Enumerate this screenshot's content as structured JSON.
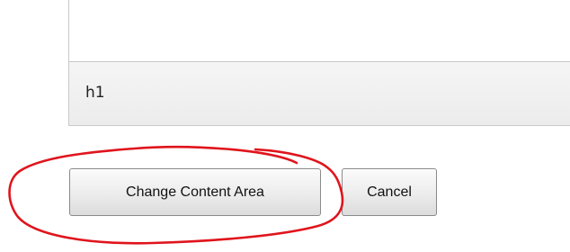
{
  "editor": {
    "status_path": "h1"
  },
  "buttons": {
    "change_content_area_label": "Change Content Area",
    "cancel_label": "Cancel"
  },
  "annotation": {
    "color": "#e0141c",
    "shape": "hand-drawn-ellipse"
  }
}
